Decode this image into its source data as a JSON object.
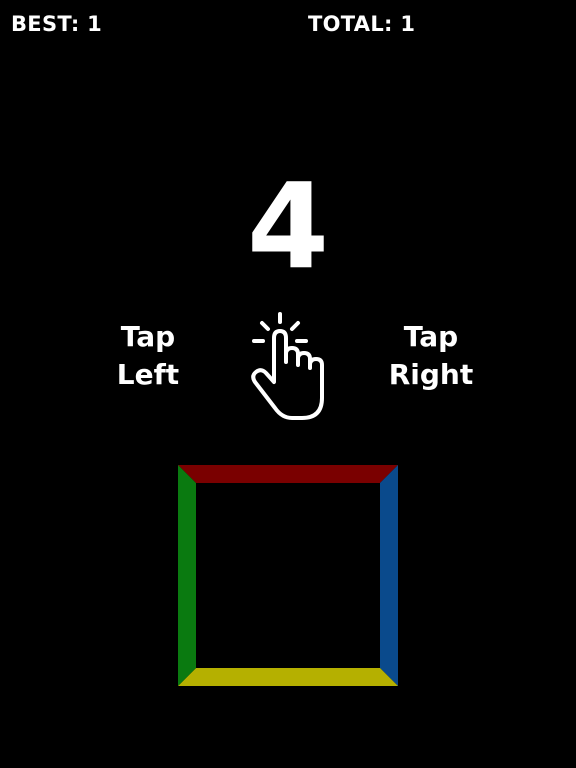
{
  "hud": {
    "best_label": "BEST: 1",
    "total_label": "TOTAL: 1"
  },
  "game": {
    "countdown": "4"
  },
  "hints": {
    "left_line1": "Tap",
    "left_line2": "Left",
    "right_line1": "Tap",
    "right_line2": "Right"
  },
  "icons": {
    "hand": "tap-hand-icon"
  },
  "board": {
    "top_color": "#7a0000",
    "right_color": "#0a4a8c",
    "bottom_color": "#b5b000",
    "left_color": "#0a7a10",
    "fill_color": "#000000"
  }
}
